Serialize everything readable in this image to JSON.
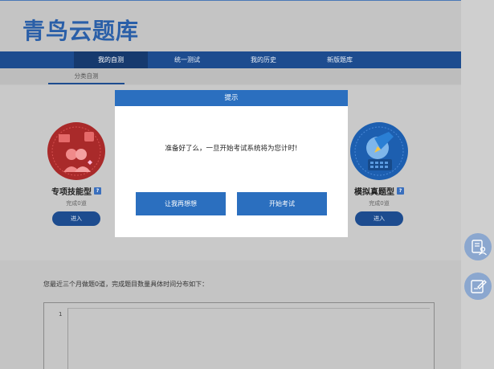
{
  "header": {
    "logo": "青鸟云题库"
  },
  "nav": {
    "items": [
      {
        "label": "我的自测",
        "active": true
      },
      {
        "label": "统一测试",
        "active": false
      },
      {
        "label": "我的历史",
        "active": false
      },
      {
        "label": "新版题库",
        "active": false
      }
    ]
  },
  "subnav": {
    "active_tab": "分类自测"
  },
  "cards": [
    {
      "title": "专项技能型",
      "badge": "?",
      "status": "完成0道",
      "button": "进入",
      "icon": "skill-icon",
      "color": "#a92a2a"
    },
    {
      "title": "模拟真题型",
      "badge": "?",
      "status": "完成0道",
      "button": "进入",
      "icon": "exam-icon",
      "color": "#1d5fb0"
    }
  ],
  "stats": {
    "summary": "您最近三个月做题0道，完成题目数量具体时间分布如下：",
    "y_tick": "1"
  },
  "modal": {
    "title": "提示",
    "message": "准备好了么，一旦开始考试系统将为您计时!",
    "cancel_label": "让我再想想",
    "confirm_label": "开始考试"
  },
  "sidebar": [
    {
      "icon": "chat-user-icon"
    },
    {
      "icon": "edit-icon"
    }
  ],
  "colors": {
    "primary": "#2b6fbf",
    "nav": "#1d4c8f",
    "accent_red": "#a92a2a"
  }
}
